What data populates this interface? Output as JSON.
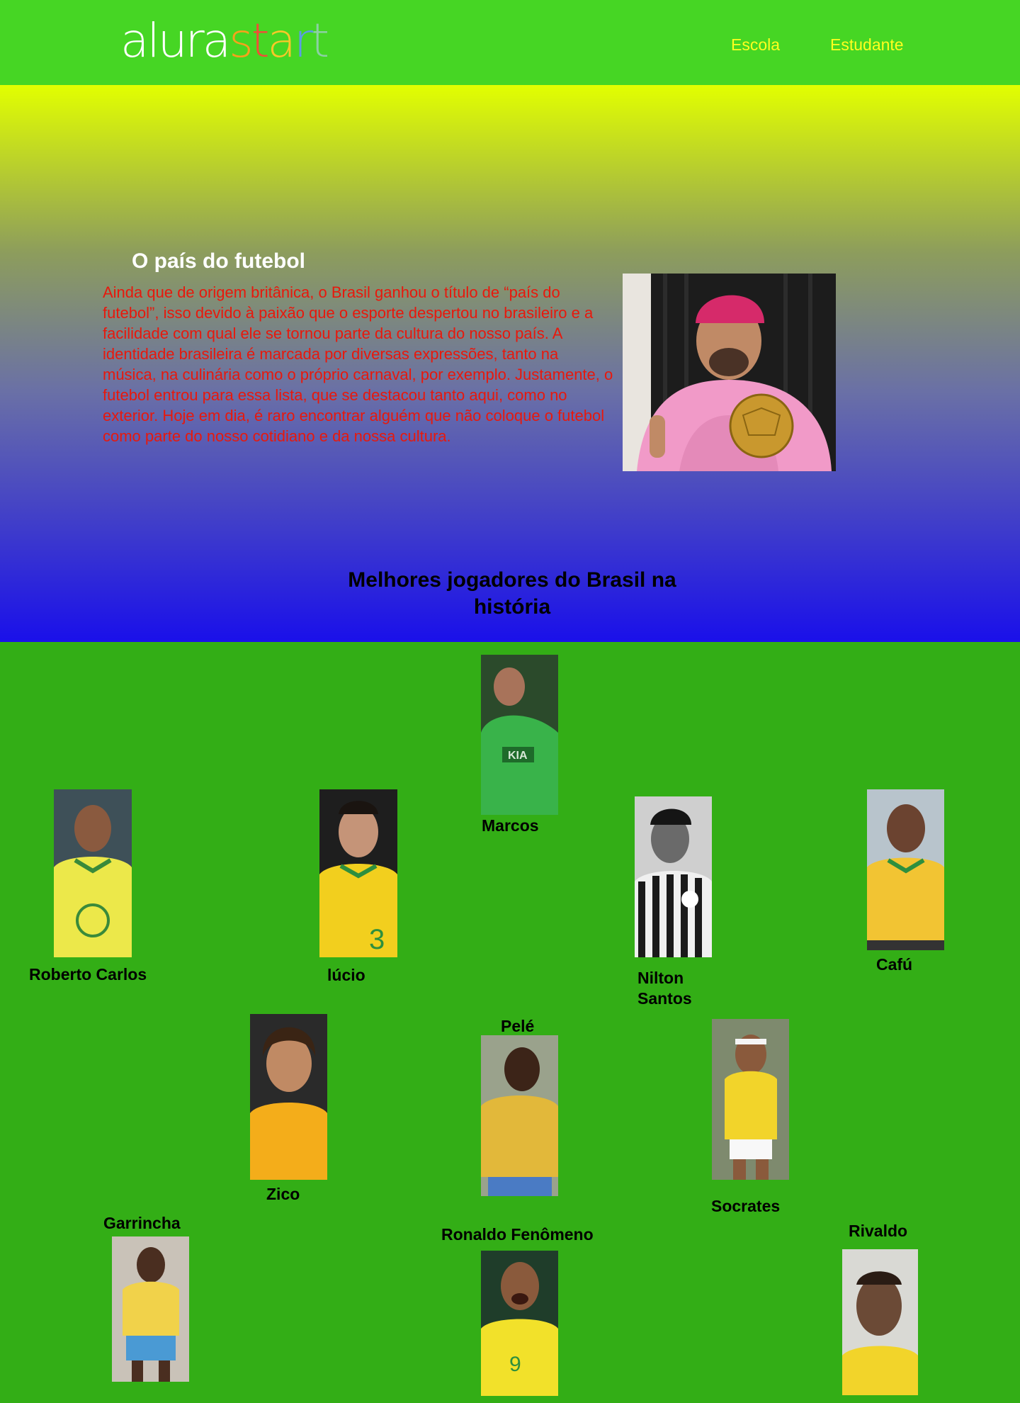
{
  "header": {
    "logo_part1": "alura",
    "logo_part2": [
      "s",
      "t",
      "a",
      "r",
      "t"
    ],
    "nav": [
      "Escola",
      "Estudante"
    ],
    "colors": {
      "bar": "#46d624",
      "nav_text": "#ffff1e"
    }
  },
  "hero": {
    "title": "O país do futebol",
    "paragraph": "Ainda que de origem britânica, o Brasil ganhou o título de “país do futebol”, isso devido à paixão que o esporte despertou no brasileiro e a facilidade com qual ele se tornou parte da cultura do nosso país. A identidade brasileira é marcada por diversas expressões, tanto na música, na culinária como o próprio carnaval, por exemplo. Justamente, o futebol entrou para essa lista, que se destacou tanto aqui, como no exterior. Hoje em dia, é raro encontrar alguém que não coloque o futebol como parte do nosso cotidiano e da nossa cultura.",
    "photo_icon": "player-with-golden-ball-photo",
    "colors": {
      "paragraph": "#e8180c",
      "gradient_top": "#e2ff00",
      "gradient_bottom": "#1a10ea"
    }
  },
  "section": {
    "title": "Melhores jogadores do Brasil na história",
    "background": "#33ae16"
  },
  "players": [
    "Marcos",
    "Roberto Carlos",
    "lúcio",
    "Nilton Santos",
    "Cafú",
    "Pelé",
    "Zico",
    "Socrates",
    "Garrincha",
    "Ronaldo Fenômeno",
    "Rivaldo"
  ]
}
